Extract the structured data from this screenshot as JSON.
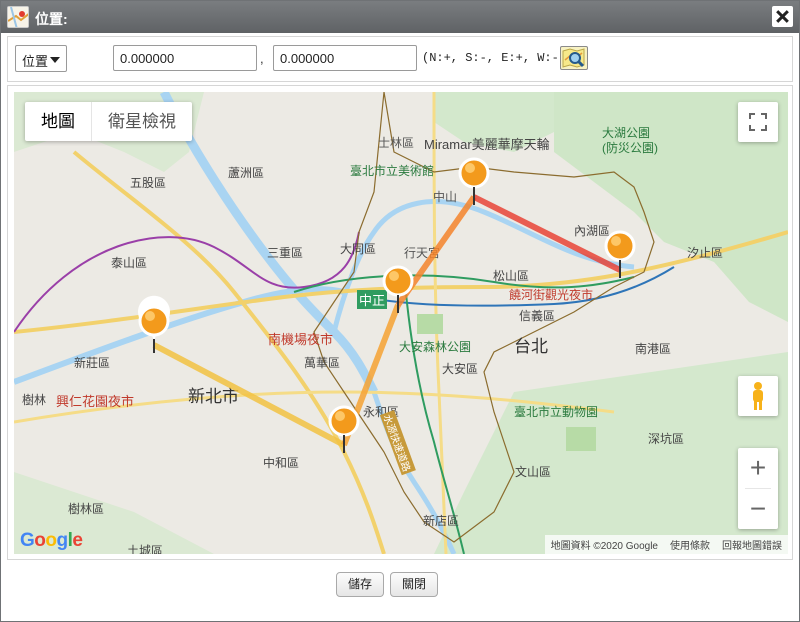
{
  "window": {
    "title": "位置:"
  },
  "toolbar": {
    "select_value": "位置",
    "latitude": "0.000000",
    "comma": ",",
    "longitude": "0.000000",
    "hint": "(N:+, S:-, E:+, W:- )"
  },
  "map": {
    "type_tabs": [
      "地圖",
      "衛星檢視"
    ],
    "zoom_in": "+",
    "zoom_out": "−",
    "attribution": [
      "地圖資料 ©2020 Google",
      "使用條款",
      "回報地圖錯誤"
    ],
    "logo": "Google",
    "labels": {
      "shilin": "士林區",
      "miramar": "Miramar美麗華摩天輪",
      "dahu_park": "大湖公園",
      "dahu_park2": "(防災公園)",
      "wugu": "五股區",
      "luzhou": "蘆洲區",
      "fine_arts": "臺北市立美術館",
      "zhongshan": "中山",
      "neihu": "內湖區",
      "sanchong": "三重區",
      "datong": "大同區",
      "xizhi": "汐止區",
      "taishan": "泰山區",
      "songshan": "松山區",
      "raohe": "饒河街觀光夜市",
      "zhongzheng": "中正",
      "xinyi": "信義區",
      "taipei": "台北",
      "xinzhuang": "新莊區",
      "nanjichang": "南機場夜市",
      "wanhua": "萬華區",
      "daan_park": "大安森林公園",
      "daan": "大安區",
      "nangang": "南港區",
      "xinbei": "新北市",
      "shulin": "樹林",
      "xingren": "興仁花園夜市",
      "yonghe": "永和區",
      "zoo": "臺北市立動物園",
      "shenkeng": "深坑區",
      "zhonghe": "中和區",
      "wenshan": "文山區",
      "shulin_dist": "樹林區",
      "xindian": "新店區",
      "tucheng": "土城區",
      "xingtian": "行天宮",
      "route": "水源快速道路"
    }
  },
  "markers": [
    {
      "name": "marker-xinzhuang"
    },
    {
      "name": "marker-zhonghe"
    },
    {
      "name": "marker-zhongzheng"
    },
    {
      "name": "marker-zhongshan"
    },
    {
      "name": "marker-neihu"
    }
  ],
  "footer": {
    "save": "儲存",
    "close": "關閉"
  },
  "colors": {
    "route_start": "#f5c342",
    "route_end": "#e8392c",
    "titlebar": "#6a6d70",
    "marker": "#f39a1c"
  }
}
